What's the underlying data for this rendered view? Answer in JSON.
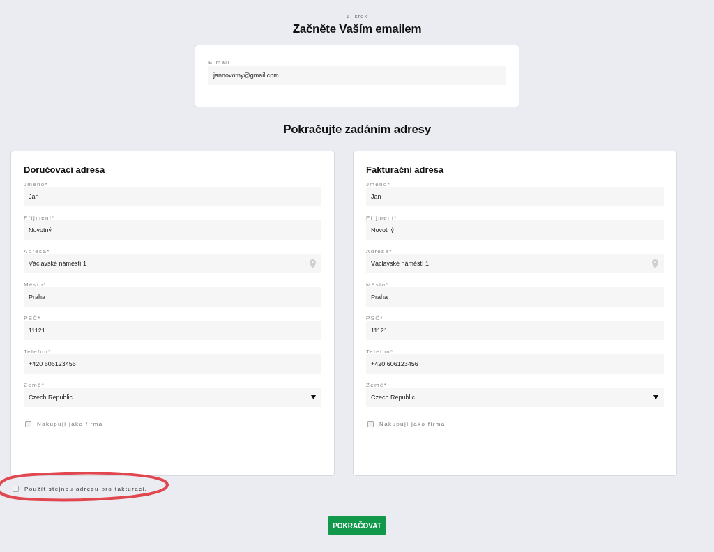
{
  "step": "1. krok",
  "email_heading": "Začněte Vaším emailem",
  "email_field": {
    "label": "E-mail",
    "value": "jannovotny@gmail.com"
  },
  "address_heading": "Pokračujte zadáním adresy",
  "address_cards": [
    {
      "title": "Doručovací adresa",
      "fields": [
        {
          "kind": "text",
          "label": "Jméno*",
          "value": "Jan"
        },
        {
          "kind": "text",
          "label": "Příjmení*",
          "value": "Novotný"
        },
        {
          "kind": "address",
          "label": "Adresa*",
          "value": "Václavské náměstí 1"
        },
        {
          "kind": "text",
          "label": "Město*",
          "value": "Praha"
        },
        {
          "kind": "text",
          "label": "PSČ*",
          "value": "11121"
        },
        {
          "kind": "text",
          "label": "Telefon*",
          "value": "+420 606123456"
        },
        {
          "kind": "select",
          "label": "Země*",
          "value": "Czech Republic"
        }
      ],
      "company": {
        "label": "Nakupuji jako firma",
        "checked": false
      }
    },
    {
      "title": "Fakturační adresa",
      "fields": [
        {
          "kind": "text",
          "label": "Jméno*",
          "value": "Jan"
        },
        {
          "kind": "text",
          "label": "Příjmení*",
          "value": "Novotný"
        },
        {
          "kind": "address",
          "label": "Adresa*",
          "value": "Václavské náměstí 1"
        },
        {
          "kind": "text",
          "label": "Město*",
          "value": "Praha"
        },
        {
          "kind": "text",
          "label": "PSČ*",
          "value": "11121"
        },
        {
          "kind": "text",
          "label": "Telefon*",
          "value": "+420 606123456"
        },
        {
          "kind": "select",
          "label": "Země*",
          "value": "Czech Republic"
        }
      ],
      "company": {
        "label": "Nakupuji jako firma",
        "checked": false
      }
    }
  ],
  "same_address": {
    "label": "Použít stejnou adresu pro fakturaci.",
    "checked": false
  },
  "continue_button": "POKRAČOVAT"
}
